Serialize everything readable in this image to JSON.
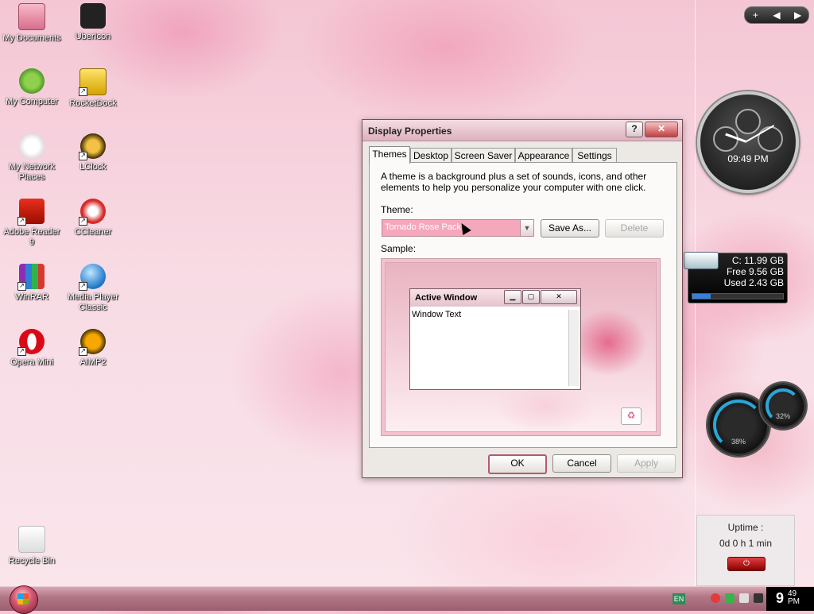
{
  "desktop": {
    "icons": [
      {
        "label": "My Documents"
      },
      {
        "label": "UberIcon"
      },
      {
        "label": "My Computer"
      },
      {
        "label": "RocketDock"
      },
      {
        "label": "My Network Places"
      },
      {
        "label": "LClock"
      },
      {
        "label": "Adobe Reader 9"
      },
      {
        "label": "CCleaner"
      },
      {
        "label": "WinRAR"
      },
      {
        "label": "Media Player Classic"
      },
      {
        "label": "Opera Mini"
      },
      {
        "label": "AIMP2"
      },
      {
        "label": "Recycle Bin"
      }
    ]
  },
  "sidebar": {
    "controls": [
      "+",
      "◀",
      "▶"
    ],
    "clock_time": "09:49 PM",
    "drive": {
      "line1": "C:  11.99 GB",
      "line2": "Free 9.56 GB",
      "line3": "Used 2.43 GB",
      "used_fraction": 0.2
    },
    "meter_cpu": "38%",
    "meter_mem": "32%",
    "uptime": {
      "label": "Uptime :",
      "value": "0d 0 h 1 min"
    }
  },
  "dialog": {
    "title": "Display Properties",
    "help_label": "?",
    "close_label": "✕",
    "tabs": [
      "Themes",
      "Desktop",
      "Screen Saver",
      "Appearance",
      "Settings"
    ],
    "description": "A theme is a background plus a set of sounds, icons, and other elements to help you personalize your computer with one click.",
    "theme_label": "Theme:",
    "theme_value": "Tornado Rose Pack",
    "save_as": "Save As...",
    "delete": "Delete",
    "sample_label": "Sample:",
    "sample_window_title": "Active Window",
    "sample_window_text": "Window Text",
    "ok": "OK",
    "cancel": "Cancel",
    "apply": "Apply"
  },
  "taskbar": {
    "lang": "EN",
    "clock_hour": "9",
    "clock_minutes": "49",
    "clock_ampm": "PM"
  }
}
